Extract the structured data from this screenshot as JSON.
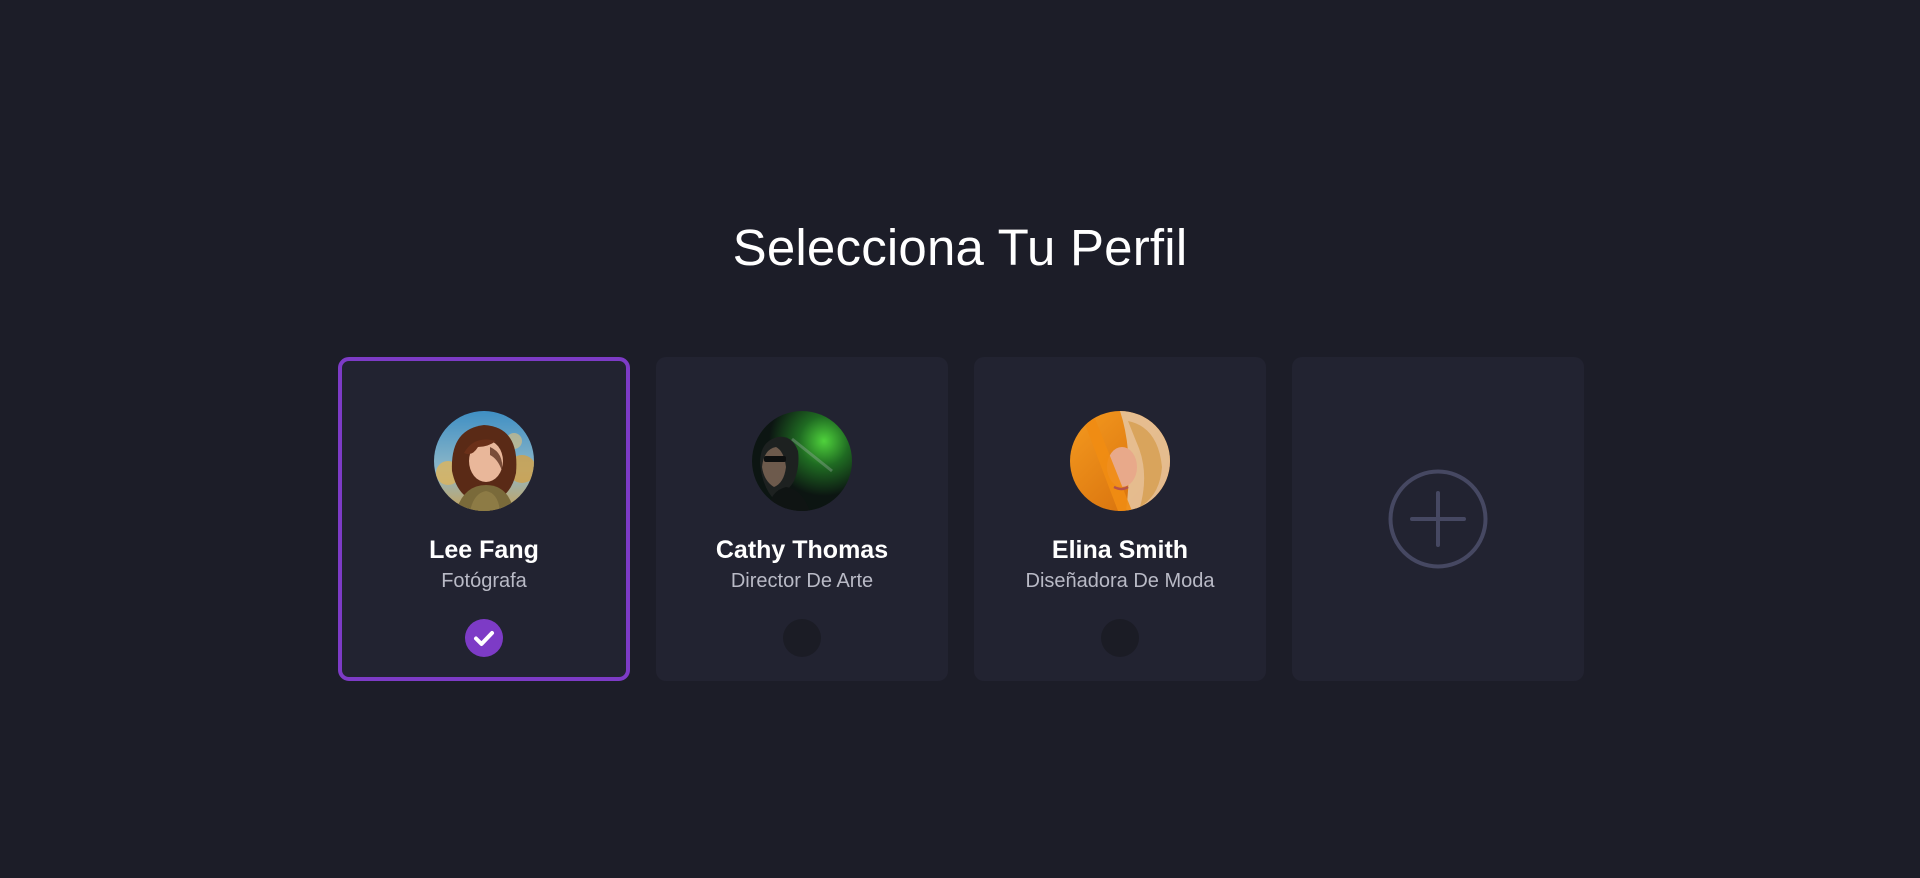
{
  "page": {
    "title": "Selecciona Tu Perfil"
  },
  "colors": {
    "background": "#1c1d28",
    "card": "#222331",
    "accent": "#7d3bc6",
    "muted_text": "#b9bac6",
    "add_icon": "#464862"
  },
  "profiles": [
    {
      "name": "Lee Fang",
      "role": "Fotógrafa",
      "selected": true,
      "avatar_icon": "avatar-photo-lee-fang"
    },
    {
      "name": "Cathy Thomas",
      "role": "Director De Arte",
      "selected": false,
      "avatar_icon": "avatar-photo-cathy-thomas"
    },
    {
      "name": "Elina Smith",
      "role": "Diseñadora De Moda",
      "selected": false,
      "avatar_icon": "avatar-photo-elina-smith"
    }
  ],
  "add_profile": {
    "icon": "plus-circle-icon"
  }
}
